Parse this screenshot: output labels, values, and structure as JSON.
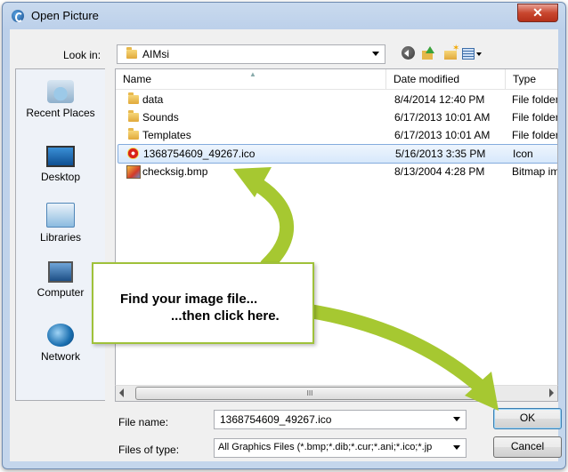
{
  "window": {
    "title": "Open Picture",
    "close_glyph": "✕"
  },
  "toolbar": {
    "look_in_label": "Look in:",
    "look_in_value": "AIMsi",
    "icons": [
      "back-icon",
      "up-folder-icon",
      "new-folder-icon",
      "view-menu-icon"
    ]
  },
  "places": [
    {
      "label": "Recent Places",
      "icon": "recent-places-icon"
    },
    {
      "label": "Desktop",
      "icon": "desktop-icon"
    },
    {
      "label": "Libraries",
      "icon": "libraries-icon"
    },
    {
      "label": "Computer",
      "icon": "computer-icon"
    },
    {
      "label": "Network",
      "icon": "network-icon"
    }
  ],
  "columns": {
    "name": "Name",
    "date": "Date modified",
    "type": "Type"
  },
  "files": [
    {
      "name": "data",
      "date": "8/4/2014 12:40 PM",
      "type": "File folder",
      "icon": "folder-icon"
    },
    {
      "name": "Sounds",
      "date": "6/17/2013 10:01 AM",
      "type": "File folder",
      "icon": "folder-icon"
    },
    {
      "name": "Templates",
      "date": "6/17/2013 10:01 AM",
      "type": "File folder",
      "icon": "folder-icon"
    },
    {
      "name": "1368754609_49267.ico",
      "date": "5/16/2013 3:35 PM",
      "type": "Icon",
      "icon": "ico-file-icon",
      "selected": true
    },
    {
      "name": "checksig.bmp",
      "date": "8/13/2004 4:28 PM",
      "type": "Bitmap im",
      "icon": "bmp-file-icon"
    }
  ],
  "scrollbar": {
    "thumb_glyph": "III"
  },
  "file_name": {
    "label": "File name:",
    "value": "1368754609_49267.ico"
  },
  "file_type": {
    "label": "Files of type:",
    "value": "All Graphics Files (*.bmp;*.dib;*.cur;*.ani;*.ico;*.jp"
  },
  "buttons": {
    "ok": "OK",
    "cancel": "Cancel"
  },
  "callout": {
    "line1": "Find your image file...",
    "line2": "...then click here."
  },
  "colors": {
    "accent_green": "#a6c831",
    "selection_border": "#84acdd",
    "title_close": "#c9472f"
  }
}
